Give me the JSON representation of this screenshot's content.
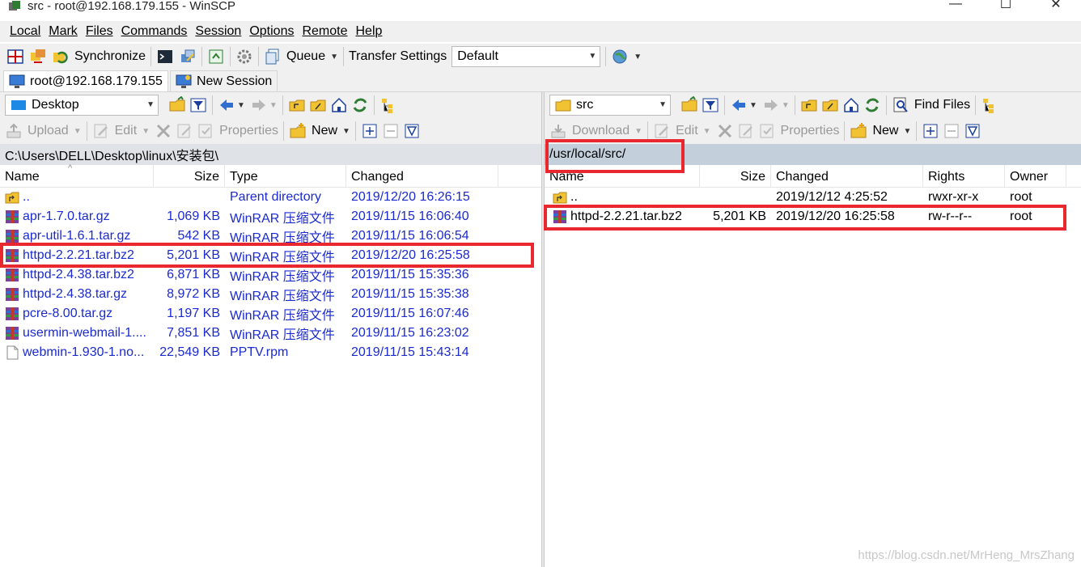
{
  "window": {
    "title": "src - root@192.168.179.155 - WinSCP",
    "buttons": {
      "minimize": "—",
      "maximize": "☐",
      "close": "✕"
    }
  },
  "menu": [
    "Local",
    "Mark",
    "Files",
    "Commands",
    "Session",
    "Options",
    "Remote",
    "Help"
  ],
  "toolbar": {
    "synchronize_label": "Synchronize",
    "queue_label": "Queue",
    "transfer_settings_label": "Transfer Settings",
    "transfer_preset": "Default"
  },
  "tabs": [
    {
      "label": "root@192.168.179.155",
      "icon": "monitor-icon"
    },
    {
      "label": "New Session",
      "icon": "new-session-icon"
    }
  ],
  "local": {
    "location": "Desktop",
    "upload_label": "Upload",
    "edit_label": "Edit",
    "properties_label": "Properties",
    "new_label": "New",
    "path": "C:\\Users\\DELL\\Desktop\\linux\\安装包\\",
    "columns": [
      "Name",
      "Size",
      "Type",
      "Changed"
    ],
    "files": [
      {
        "name": "..",
        "size": "",
        "type": "Parent directory",
        "changed": "2019/12/20  16:26:15",
        "icon": "parent-dir-icon"
      },
      {
        "name": "apr-1.7.0.tar.gz",
        "size": "1,069 KB",
        "type": "WinRAR 压缩文件",
        "changed": "2019/11/15  16:06:40",
        "icon": "winrar-icon"
      },
      {
        "name": "apr-util-1.6.1.tar.gz",
        "size": "542 KB",
        "type": "WinRAR 压缩文件",
        "changed": "2019/11/15  16:06:54",
        "icon": "winrar-icon"
      },
      {
        "name": "httpd-2.2.21.tar.bz2",
        "size": "5,201 KB",
        "type": "WinRAR 压缩文件",
        "changed": "2019/12/20  16:25:58",
        "icon": "winrar-icon"
      },
      {
        "name": "httpd-2.4.38.tar.bz2",
        "size": "6,871 KB",
        "type": "WinRAR 压缩文件",
        "changed": "2019/11/15  15:35:36",
        "icon": "winrar-icon"
      },
      {
        "name": "httpd-2.4.38.tar.gz",
        "size": "8,972 KB",
        "type": "WinRAR 压缩文件",
        "changed": "2019/11/15  15:35:38",
        "icon": "winrar-icon"
      },
      {
        "name": "pcre-8.00.tar.gz",
        "size": "1,197 KB",
        "type": "WinRAR 压缩文件",
        "changed": "2019/11/15  16:07:46",
        "icon": "winrar-icon"
      },
      {
        "name": "usermin-webmail-1....",
        "size": "7,851 KB",
        "type": "WinRAR 压缩文件",
        "changed": "2019/11/15  16:23:02",
        "icon": "winrar-icon"
      },
      {
        "name": "webmin-1.930-1.no...",
        "size": "22,549 KB",
        "type": "PPTV.rpm",
        "changed": "2019/11/15  15:43:14",
        "icon": "file-icon"
      }
    ]
  },
  "remote": {
    "location": "src",
    "find_files_label": "Find Files",
    "download_label": "Download",
    "edit_label": "Edit",
    "properties_label": "Properties",
    "new_label": "New",
    "path": "/usr/local/src/",
    "columns": [
      "Name",
      "Size",
      "Changed",
      "Rights",
      "Owner"
    ],
    "files": [
      {
        "name": "..",
        "size": "",
        "changed": "2019/12/12 4:25:52",
        "rights": "rwxr-xr-x",
        "owner": "root",
        "icon": "parent-dir-icon"
      },
      {
        "name": "httpd-2.2.21.tar.bz2",
        "size": "5,201 KB",
        "changed": "2019/12/20 16:25:58",
        "rights": "rw-r--r--",
        "owner": "root",
        "icon": "winrar-icon"
      }
    ]
  },
  "watermark": "https://blog.csdn.net/MrHeng_MrsZhang",
  "colors": {
    "highlight": "#e8282e",
    "link_blue": "#1a2ad0",
    "path_active": "#c4cfdc"
  }
}
